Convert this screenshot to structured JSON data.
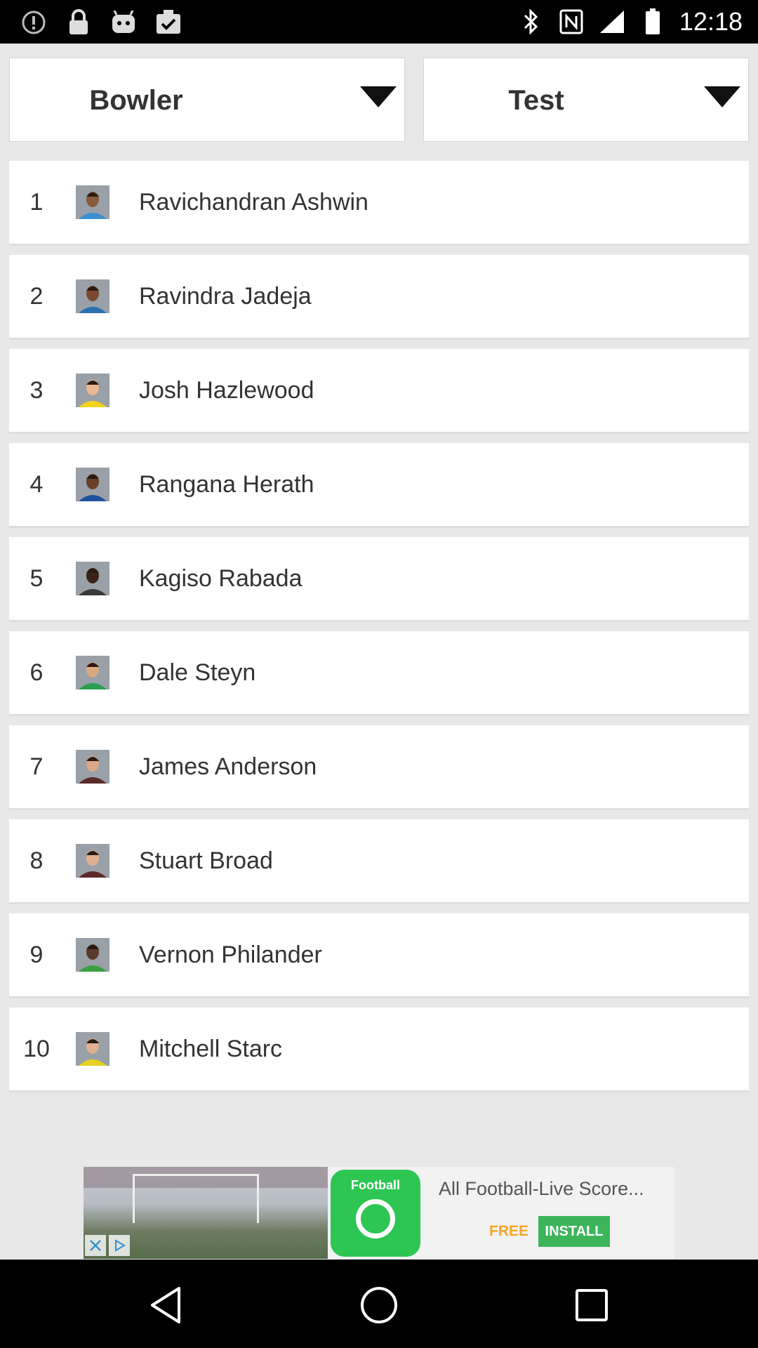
{
  "status_bar": {
    "time": "12:18",
    "left_icons": [
      "alert-circle-icon",
      "lock-icon",
      "android-icon",
      "clipboard-check-icon"
    ],
    "right_icons": [
      "bluetooth-icon",
      "nfc-icon",
      "signal-icon",
      "battery-icon"
    ]
  },
  "filters": {
    "category": {
      "label": "Bowler"
    },
    "format": {
      "label": "Test"
    }
  },
  "rankings": [
    {
      "rank": "1",
      "name": "Ravichandran Ashwin",
      "jersey": "#3a8fd0",
      "skin": "#8a5a3c"
    },
    {
      "rank": "2",
      "name": "Ravindra Jadeja",
      "jersey": "#2a6fb0",
      "skin": "#7a4a30"
    },
    {
      "rank": "3",
      "name": "Josh Hazlewood",
      "jersey": "#f2d21a",
      "skin": "#e8b890"
    },
    {
      "rank": "4",
      "name": "Rangana Herath",
      "jersey": "#2050a0",
      "skin": "#6a4028"
    },
    {
      "rank": "5",
      "name": "Kagiso Rabada",
      "jersey": "#3a3a3a",
      "skin": "#3a2218"
    },
    {
      "rank": "6",
      "name": "Dale Steyn",
      "jersey": "#2aa050",
      "skin": "#d8a880"
    },
    {
      "rank": "7",
      "name": "James Anderson",
      "jersey": "#5a2a2a",
      "skin": "#d8a888"
    },
    {
      "rank": "8",
      "name": "Stuart Broad",
      "jersey": "#5a2a2a",
      "skin": "#e0b090"
    },
    {
      "rank": "9",
      "name": "Vernon Philander",
      "jersey": "#3aa040",
      "skin": "#5a3a28"
    },
    {
      "rank": "10",
      "name": "Mitchell Starc",
      "jersey": "#e8d020",
      "skin": "#e0b090"
    }
  ],
  "ad": {
    "app_logo_text": "Football",
    "title": "All Football-Live Score...",
    "free_label": "FREE",
    "install_label": "INSTALL"
  },
  "colors": {
    "background": "#e8e8e8",
    "card": "#ffffff",
    "text": "#333333",
    "ad_green": "#3cb55a",
    "ad_orange": "#f5a623"
  }
}
